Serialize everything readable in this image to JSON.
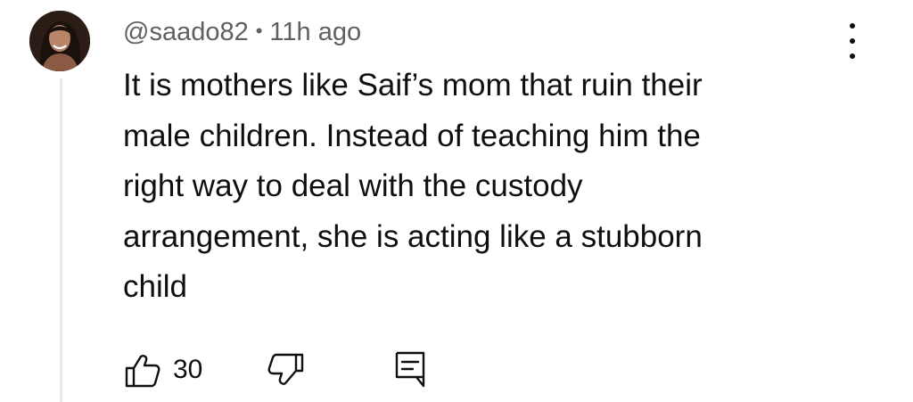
{
  "comment": {
    "username": "@saado82",
    "separator": "•",
    "timestamp": "11h ago",
    "lines": [
      "It is mothers like Saif’s mom that ruin their",
      "male children. Instead of teaching him the",
      "right way to deal with the custody",
      "arrangement, she is acting like a stubborn",
      "child"
    ],
    "like_count": "30"
  },
  "icons": {
    "avatar": "avatar-photo",
    "menu": "more-vertical-icon",
    "like": "thumbs-up-icon",
    "dislike": "thumbs-down-icon",
    "reply": "reply-comment-icon"
  }
}
